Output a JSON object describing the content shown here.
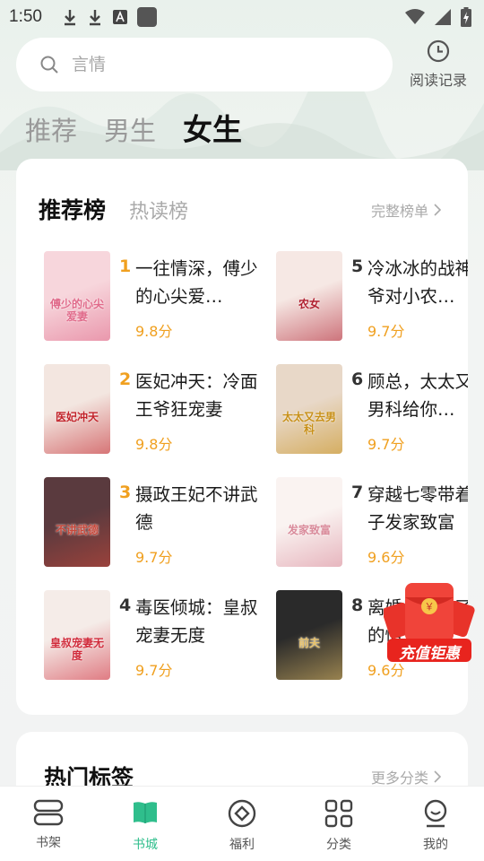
{
  "status_bar": {
    "time": "1:50"
  },
  "search": {
    "placeholder": "言情"
  },
  "history": {
    "label": "阅读记录"
  },
  "channel_tabs": [
    {
      "label": "推荐",
      "active": false
    },
    {
      "label": "男生",
      "active": false
    },
    {
      "label": "女生",
      "active": true
    }
  ],
  "ranking": {
    "tabs": [
      {
        "label": "推荐榜",
        "active": true
      },
      {
        "label": "热读榜",
        "active": false
      }
    ],
    "full_list_label": "完整榜单",
    "books": [
      {
        "rank": "1",
        "title": "一往情深，傅少的心尖爱…",
        "score": "9.8分",
        "cover_text": "傅少的心尖爱妻",
        "cover_colors": [
          "#f7d6dc",
          "#e06a8a"
        ],
        "rank_color": "#f0a020"
      },
      {
        "rank": "2",
        "title": "医妃冲天：冷面王爷狂宠妻",
        "score": "9.8分",
        "cover_text": "医妃冲天",
        "cover_colors": [
          "#f3e6e0",
          "#c2232a"
        ],
        "rank_color": "#f0a020"
      },
      {
        "rank": "3",
        "title": "摄政王妃不讲武德",
        "score": "9.7分",
        "cover_text": "不讲武德",
        "cover_colors": [
          "#5a3a3e",
          "#c8473a"
        ],
        "rank_color": "#f0a020"
      },
      {
        "rank": "4",
        "title": "毒医倾城：皇叔宠妻无度",
        "score": "9.7分",
        "cover_text": "皇叔宠妻无度",
        "cover_colors": [
          "#f5ece8",
          "#d02a3a"
        ],
        "rank_color": "#333333"
      },
      {
        "rank": "5",
        "title": "冷冰冰的战神王爷对小农…",
        "score": "9.7分",
        "cover_text": "农女",
        "cover_colors": [
          "#f6e8e4",
          "#b02030"
        ],
        "rank_color": "#333333"
      },
      {
        "rank": "6",
        "title": "顾总，太太又去男科给你…",
        "score": "9.7分",
        "cover_text": "太太又去男科",
        "cover_colors": [
          "#e8d8c8",
          "#c89018"
        ],
        "rank_color": "#333333"
      },
      {
        "rank": "7",
        "title": "穿越七零带着崽子发家致富",
        "score": "9.6分",
        "cover_text": "发家致富",
        "cover_colors": [
          "#faf3f1",
          "#d98a9a"
        ],
        "rank_color": "#333333"
      },
      {
        "rank": "8",
        "title": "离婚后我成了他的情人",
        "score": "9.6分",
        "cover_text": "前夫",
        "cover_colors": [
          "#2a2a2a",
          "#e8c26a"
        ],
        "rank_color": "#333333"
      }
    ]
  },
  "red_packet": {
    "label": "充值钜惠"
  },
  "hot_tags": {
    "title": "热门标签",
    "more_label": "更多分类"
  },
  "bottom_nav": [
    {
      "label": "书架",
      "icon": "bookshelf-icon",
      "active": false
    },
    {
      "label": "书城",
      "icon": "bookstore-icon",
      "active": true
    },
    {
      "label": "福利",
      "icon": "welfare-icon",
      "active": false
    },
    {
      "label": "分类",
      "icon": "category-icon",
      "active": false
    },
    {
      "label": "我的",
      "icon": "profile-icon",
      "active": false
    }
  ],
  "colors": {
    "accent": "#2fbe8c",
    "score": "#f0a020",
    "rank_top": "#f0a020"
  }
}
